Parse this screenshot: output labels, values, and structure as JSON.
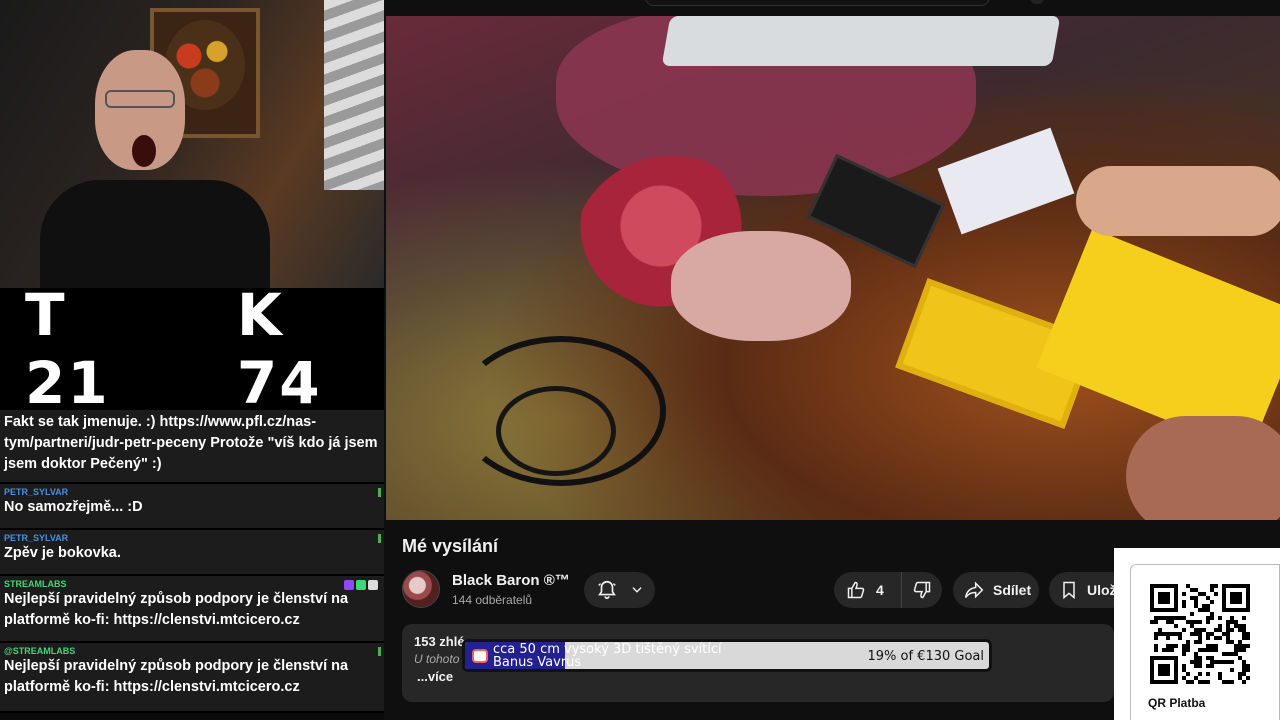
{
  "scoreboard": {
    "t_label": "T 21",
    "k_label": "K 74"
  },
  "chat": [
    {
      "author": "",
      "text": "Fakt se tak jmenuje. :) https://www.pfl.cz/nas-tym/partneri/judr-petr-peceny Protože \"víš kdo já jsem jsem doktor Pečený\" :)"
    },
    {
      "author": "PETR_SYLVAR",
      "text": "No samozřejmě... :D"
    },
    {
      "author": "PETR_SYLVAR",
      "text": "Zpěv je bokovka."
    },
    {
      "author": "STREAMLABS",
      "text": "Nejlepší pravidelný způsob podpory je členství na platformě ko-fi: https://clenstvi.mtcicero.cz"
    },
    {
      "author": "@STREAMLABS",
      "text": "Nejlepší pravidelný způsob podpory je členství na platformě ko-fi: https://clenstvi.mtcicero.cz"
    }
  ],
  "video": {
    "title": "Mé vysílání",
    "channel_name": "Black Baron ®™",
    "subscribers": "144 odběratelů",
    "likes": "4",
    "share_label": "Sdílet",
    "save_label": "Ulož",
    "views_fragment": "153 zhlé",
    "note_fragment": "U tohoto",
    "more_label": "...více"
  },
  "goal": {
    "title_line1": "cca 50 cm vysoký 3D tištěný svítící",
    "title_line2": "Banus Vavrus",
    "progress_text": "19% of €130 Goal",
    "progress_fraction": 0.19
  },
  "qr": {
    "label": "QR Platba"
  },
  "colors": {
    "goal_fill": "#23208f",
    "author_blue": "#4a8fe0",
    "author_green": "#41d67a"
  }
}
